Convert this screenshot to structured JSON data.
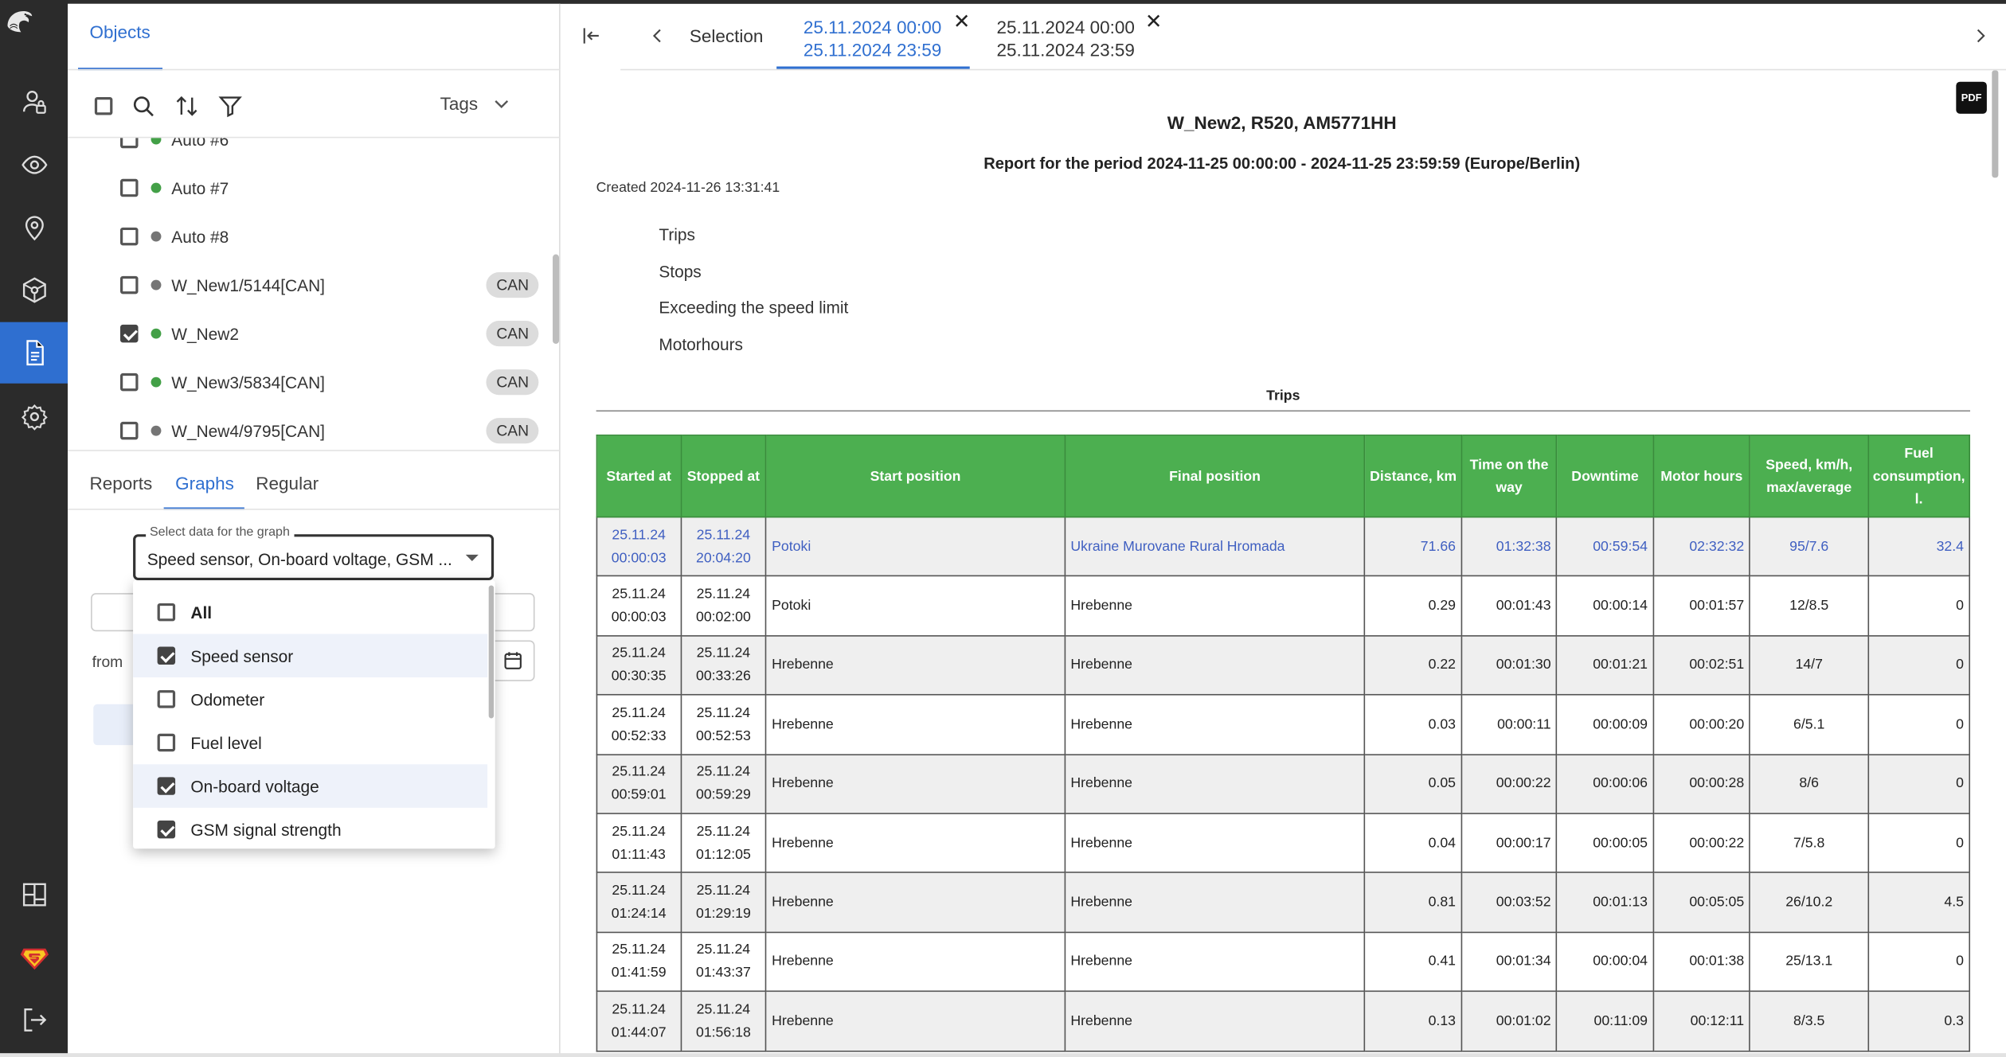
{
  "colors": {
    "accent": "#2f6fd0",
    "table_header": "#4caf50",
    "rail": "#2b2b2b"
  },
  "rail": {
    "items": [
      {
        "icon": "user-lock-icon"
      },
      {
        "icon": "eye-icon"
      },
      {
        "icon": "map-pin-icon"
      },
      {
        "icon": "steering-wheel-icon"
      },
      {
        "icon": "report-document-icon",
        "active": true
      },
      {
        "icon": "gear-icon"
      }
    ],
    "bottom": [
      {
        "icon": "layout-icon"
      },
      {
        "icon": "superman-logo-icon"
      },
      {
        "icon": "logout-icon"
      }
    ]
  },
  "objects_panel": {
    "tab": "Objects",
    "tags_label": "Tags",
    "partial_item": "Auto #6",
    "items": [
      {
        "name": "Auto #7",
        "status": "green",
        "checked": false,
        "chip": ""
      },
      {
        "name": "Auto #8",
        "status": "gray",
        "checked": false,
        "chip": ""
      },
      {
        "name": "W_New1/5144[CAN]",
        "status": "gray",
        "checked": false,
        "chip": "CAN"
      },
      {
        "name": "W_New2",
        "status": "green",
        "checked": true,
        "chip": "CAN"
      },
      {
        "name": "W_New3/5834[CAN]",
        "status": "green",
        "checked": false,
        "chip": "CAN"
      },
      {
        "name": "W_New4/9795[CAN]",
        "status": "gray",
        "checked": false,
        "chip": "CAN"
      }
    ]
  },
  "lower_tabs": {
    "reports": "Reports",
    "graphs": "Graphs",
    "regular": "Regular"
  },
  "graph_select": {
    "label": "Select data for the graph",
    "value": "Speed sensor, On-board voltage, GSM ...",
    "from_label": "from",
    "options": [
      {
        "label": "All",
        "checked": false
      },
      {
        "label": "Speed sensor",
        "checked": true
      },
      {
        "label": "Odometer",
        "checked": false
      },
      {
        "label": "Fuel level",
        "checked": false
      },
      {
        "label": "On-board voltage",
        "checked": true
      },
      {
        "label": "GSM signal strength",
        "checked": true
      }
    ]
  },
  "report_tabs": {
    "selection": "Selection",
    "tab1_line1": "25.11.2024 00:00",
    "tab1_line2": "25.11.2024 23:59",
    "tab2_line1": "25.11.2024 00:00",
    "tab2_line2": "25.11.2024 23:59"
  },
  "report": {
    "pdf_label": "PDF",
    "title": "W_New2, R520, AM5771HH",
    "period": "Report for the period 2024-11-25 00:00:00 - 2024-11-25 23:59:59 (Europe/Berlin)",
    "created": "Created 2024-11-26 13:31:41",
    "toc": [
      "Trips",
      "Stops",
      "Exceeding the speed limit",
      "Motorhours"
    ],
    "section_title": "Trips",
    "columns": [
      "Started at",
      "Stopped at",
      "Start position",
      "Final position",
      "Distance, km",
      "Time on the way",
      "Downtime",
      "Motor hours",
      "Speed, km/h, max/average",
      "Fuel consumption, l."
    ],
    "rows": [
      {
        "start_d": "25.11.24",
        "start_t": "00:00:03",
        "stop_d": "25.11.24",
        "stop_t": "20:04:20",
        "start_pos": "Potoki",
        "final_pos": "Ukraine Murovane Rural Hromada",
        "dist": "71.66",
        "time": "01:32:38",
        "down": "00:59:54",
        "motor": "02:32:32",
        "speed": "95/7.6",
        "fuel": "32.4"
      },
      {
        "start_d": "25.11.24",
        "start_t": "00:00:03",
        "stop_d": "25.11.24",
        "stop_t": "00:02:00",
        "start_pos": "Potoki",
        "final_pos": "Hrebenne",
        "dist": "0.29",
        "time": "00:01:43",
        "down": "00:00:14",
        "motor": "00:01:57",
        "speed": "12/8.5",
        "fuel": "0"
      },
      {
        "start_d": "25.11.24",
        "start_t": "00:30:35",
        "stop_d": "25.11.24",
        "stop_t": "00:33:26",
        "start_pos": "Hrebenne",
        "final_pos": "Hrebenne",
        "dist": "0.22",
        "time": "00:01:30",
        "down": "00:01:21",
        "motor": "00:02:51",
        "speed": "14/7",
        "fuel": "0"
      },
      {
        "start_d": "25.11.24",
        "start_t": "00:52:33",
        "stop_d": "25.11.24",
        "stop_t": "00:52:53",
        "start_pos": "Hrebenne",
        "final_pos": "Hrebenne",
        "dist": "0.03",
        "time": "00:00:11",
        "down": "00:00:09",
        "motor": "00:00:20",
        "speed": "6/5.1",
        "fuel": "0"
      },
      {
        "start_d": "25.11.24",
        "start_t": "00:59:01",
        "stop_d": "25.11.24",
        "stop_t": "00:59:29",
        "start_pos": "Hrebenne",
        "final_pos": "Hrebenne",
        "dist": "0.05",
        "time": "00:00:22",
        "down": "00:00:06",
        "motor": "00:00:28",
        "speed": "8/6",
        "fuel": "0"
      },
      {
        "start_d": "25.11.24",
        "start_t": "01:11:43",
        "stop_d": "25.11.24",
        "stop_t": "01:12:05",
        "start_pos": "Hrebenne",
        "final_pos": "Hrebenne",
        "dist": "0.04",
        "time": "00:00:17",
        "down": "00:00:05",
        "motor": "00:00:22",
        "speed": "7/5.8",
        "fuel": "0"
      },
      {
        "start_d": "25.11.24",
        "start_t": "01:24:14",
        "stop_d": "25.11.24",
        "stop_t": "01:29:19",
        "start_pos": "Hrebenne",
        "final_pos": "Hrebenne",
        "dist": "0.81",
        "time": "00:03:52",
        "down": "00:01:13",
        "motor": "00:05:05",
        "speed": "26/10.2",
        "fuel": "4.5"
      },
      {
        "start_d": "25.11.24",
        "start_t": "01:41:59",
        "stop_d": "25.11.24",
        "stop_t": "01:43:37",
        "start_pos": "Hrebenne",
        "final_pos": "Hrebenne",
        "dist": "0.41",
        "time": "00:01:34",
        "down": "00:00:04",
        "motor": "00:01:38",
        "speed": "25/13.1",
        "fuel": "0"
      },
      {
        "start_d": "25.11.24",
        "start_t": "01:44:07",
        "stop_d": "25.11.24",
        "stop_t": "01:56:18",
        "start_pos": "Hrebenne",
        "final_pos": "Hrebenne",
        "dist": "0.13",
        "time": "00:01:02",
        "down": "00:11:09",
        "motor": "00:12:11",
        "speed": "8/3.5",
        "fuel": "0.3"
      }
    ]
  }
}
